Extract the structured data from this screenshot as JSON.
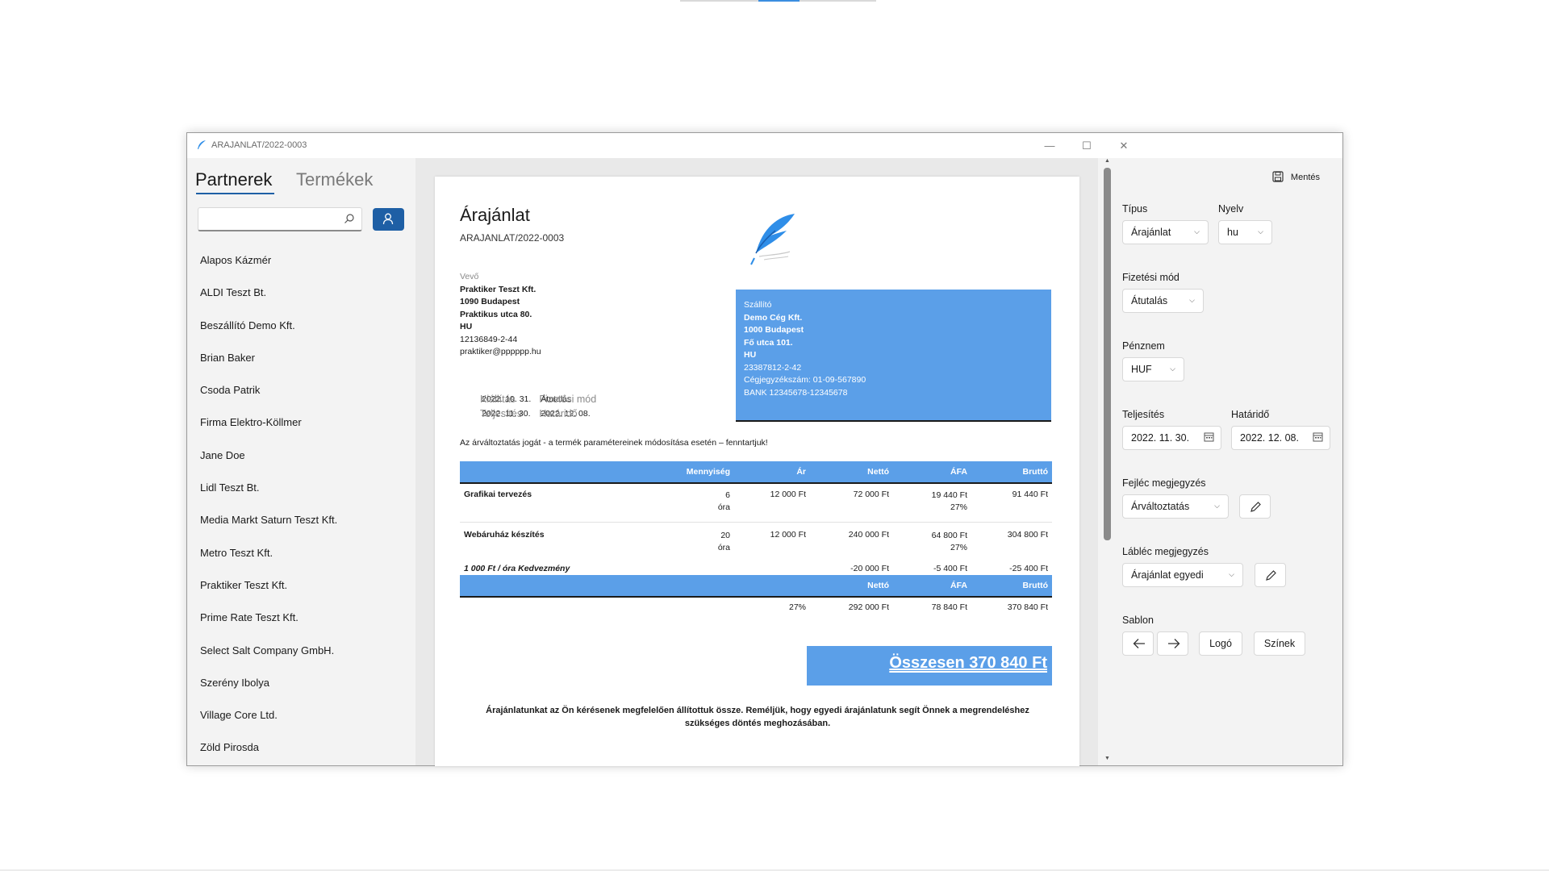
{
  "window": {
    "title": "ARAJANLAT/2022-0003",
    "minimize": "—",
    "maximize": "☐",
    "close": "✕"
  },
  "sidebar": {
    "tabs": [
      {
        "label": "Partnerek",
        "active": true
      },
      {
        "label": "Termékek",
        "active": false
      }
    ],
    "search_placeholder": "",
    "partners": [
      "Alapos Kázmér",
      "ALDI Teszt Bt.",
      "Beszállító Demo Kft.",
      "Brian Baker",
      "Csoda Patrik",
      "Firma Elektro-Köllmer",
      "Jane Doe",
      "Lidl Teszt Bt.",
      "Media Markt Saturn Teszt Kft.",
      "Metro Teszt Kft.",
      "Praktiker Teszt Kft.",
      "Prime Rate Teszt Kft.",
      "Select Salt Company GmbH.",
      "Szerény Ibolya",
      "Village Core Ltd.",
      "Zöld Pirosda"
    ]
  },
  "document": {
    "title": "Árajánlat",
    "number": "ARAJANLAT/2022-0003",
    "buyer": {
      "label": "Vevő",
      "name": "Praktiker Teszt Kft.",
      "city": "1090 Budapest",
      "street": "Praktikus utca 80.",
      "country": "HU",
      "tax": "12136849-2-44",
      "email": "praktiker@pppppp.hu"
    },
    "seller": {
      "label": "Szállító",
      "name": "Demo Cég Kft.",
      "city": "1000 Budapest",
      "street": "Fő utca 101.",
      "country": "HU",
      "tax": "23387812-2-42",
      "reg": "Cégjegyzékszám: 01-09-567890",
      "bank": "BANK 12345678-12345678"
    },
    "dates": {
      "issue_label": "Kiállítás",
      "issue": "2022. 10. 31.",
      "payment_label": "Fizetési mód",
      "payment": "Átutalás",
      "fulfil_label": "Teljesítés",
      "fulfil": "2022. 11. 30.",
      "due_label": "Határidő",
      "due": "2022. 12. 08."
    },
    "disclaimer": "Az árváltoztatás jogát - a termék paramétereinek módosítása esetén – fenntartjuk!",
    "table_headers": {
      "qty": "Mennyiség",
      "price": "Ár",
      "net": "Nettó",
      "vat": "ÁFA",
      "gross": "Bruttó"
    },
    "items": [
      {
        "name": "Grafikai tervezés",
        "qty": "6",
        "unit": "óra",
        "price": "12 000 Ft",
        "net": "72 000 Ft",
        "vat": "19 440 Ft",
        "vat_rate": "27%",
        "gross": "91 440 Ft"
      },
      {
        "name": "Webáruház készítés",
        "qty": "20",
        "unit": "óra",
        "price": "12 000 Ft",
        "net": "240 000 Ft",
        "vat": "64 800 Ft",
        "vat_rate": "27%",
        "gross": "304 800 Ft"
      }
    ],
    "discount": {
      "name": "1 000 Ft / óra Kedvezmény",
      "net": "-20 000 Ft",
      "vat": "-5 400 Ft",
      "gross": "-25 400 Ft"
    },
    "summary_headers": {
      "net": "Nettó",
      "vat": "ÁFA",
      "gross": "Bruttó"
    },
    "summary": {
      "rate": "27%",
      "net": "292 000 Ft",
      "vat": "78 840 Ft",
      "gross": "370 840 Ft"
    },
    "total": "Összesen 370 840 Ft",
    "footer_note": "Árajánlatunkat az Ön kérésenek megfelelően állítottuk össze. Reméljük, hogy egyedi árajánlatunk segít Önnek a megrendeléshez szükséges döntés meghozásában."
  },
  "settings": {
    "save": "Mentés",
    "type_label": "Típus",
    "type_value": "Árajánlat",
    "lang_label": "Nyelv",
    "lang_value": "hu",
    "payment_label": "Fizetési mód",
    "payment_value": "Átutalás",
    "currency_label": "Pénznem",
    "currency_value": "HUF",
    "fulfil_label": "Teljesítés",
    "fulfil_value": "2022. 11. 30.",
    "due_label": "Határidő",
    "due_value": "2022. 12. 08.",
    "header_note_label": "Fejléc megjegyzés",
    "header_note_value": "Árváltoztatás",
    "footer_note_label": "Lábléc megjegyzés",
    "footer_note_value": "Árajánlat egyedi",
    "template_label": "Sablon",
    "logo_button": "Logó",
    "colors_button": "Színek"
  },
  "colors": {
    "accent": "#1e5fa5",
    "doc_blue": "#5b9fe8"
  }
}
